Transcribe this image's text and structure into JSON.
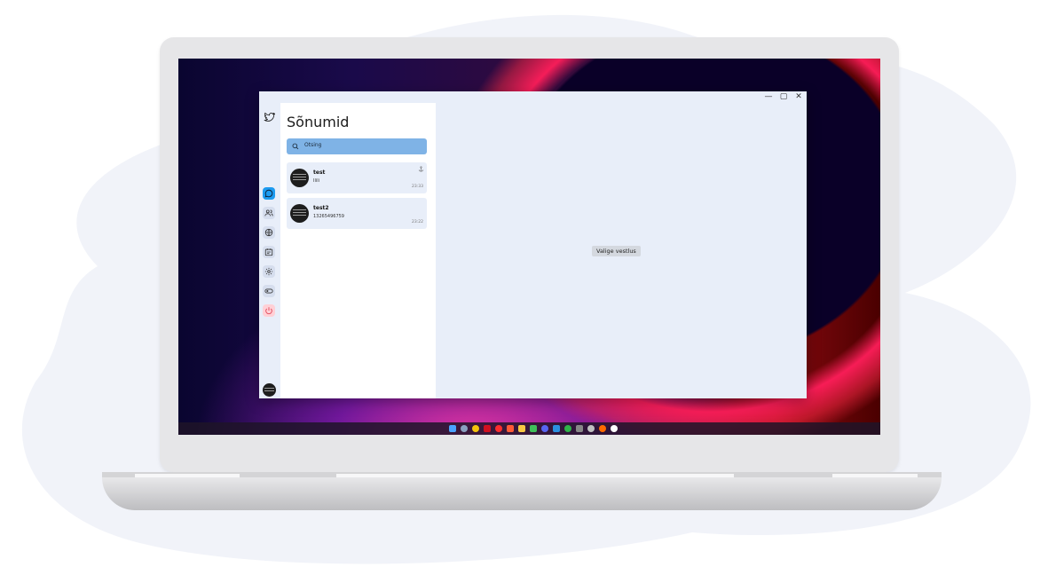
{
  "window": {
    "minimize": "—",
    "maximize": "▢",
    "close": "✕"
  },
  "sidebar": {
    "logo_icon": "bird-icon",
    "items": [
      {
        "icon": "chat-icon",
        "active": true
      },
      {
        "icon": "users-icon"
      },
      {
        "icon": "globe-icon"
      },
      {
        "icon": "calendar-icon"
      },
      {
        "icon": "gear-icon"
      },
      {
        "icon": "toggle-icon"
      },
      {
        "icon": "power-icon"
      }
    ]
  },
  "conversations": {
    "title": "Sõnumid",
    "search_placeholder": "Otsing",
    "items": [
      {
        "name": "test",
        "last_message": "Ilili",
        "time": "23:33",
        "pinned": true
      },
      {
        "name": "test2",
        "last_message": "13265496759",
        "time": "23:22",
        "pinned": false
      }
    ]
  },
  "main": {
    "empty_label": "Valige vestlus"
  },
  "colors": {
    "accent": "#7fb3e6",
    "surface": "#e8eef9",
    "active_item": "#1d9bf0",
    "danger": "#ffd0d6"
  }
}
